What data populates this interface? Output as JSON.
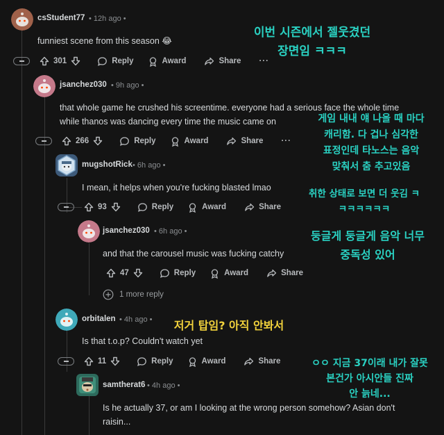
{
  "comments": [
    {
      "author": "csStudent77",
      "time": "12h ago",
      "text": [
        "funniest scene from this season 😂"
      ],
      "votes": "301"
    },
    {
      "author": "jsanchez030",
      "time": "9h ago",
      "text": [
        "that whole game he crushed his screentime. everyone had a serious face the whole time",
        "while thanos was dancing every time the music came on"
      ],
      "votes": "266"
    },
    {
      "author": "mugshotRick",
      "time": "6h ago",
      "text": [
        "I mean, it helps when you're fucking blasted lmao"
      ],
      "votes": "93"
    },
    {
      "author": "jsanchez030",
      "time": "6h ago",
      "text": [
        "and that the carousel music was fucking catchy"
      ],
      "votes": "47"
    },
    {
      "author": "orbitalen",
      "time": "4h ago",
      "text": [
        "Is that t.o.p? Couldn't watch yet"
      ],
      "votes": "11"
    },
    {
      "author": "samtherat6",
      "time": "4h ago",
      "text": [
        "Is he actually 37, or am I looking at the wrong person somehow? Asian don't",
        "raisin..."
      ]
    }
  ],
  "actions": {
    "reply": "Reply",
    "award": "Award",
    "share": "Share",
    "more": "···"
  },
  "more_replies": "1 more reply",
  "dot": "•",
  "translations": [
    [
      "이번 시즌에서 젤웃겼던",
      "장면임 ㅋㅋㅋ"
    ],
    [
      "게임 내내 얘 나올 때 마다",
      "캐리함. 다 겁나 심각한",
      "표정인데 타노스는 음악",
      "맞춰서 춤 추고있음"
    ],
    [
      "취한 상태로 보면 더 웃김 ㅋ",
      "ㅋㅋㅋㅋㅋㅋ"
    ],
    [
      "둥글게 둥글게 음악 너무",
      "중독성 있어"
    ],
    [
      "저거 탑임? 아직 안봐서"
    ],
    [
      "ㅇㅇ 지금 37이래 내가 잘못",
      "본건가 아시안들 진짜",
      "안 늙네..."
    ]
  ],
  "colors": {
    "background": "#141414",
    "text": "#d7dadc",
    "meta": "#8a8d90",
    "overlay": "#2ad1c2"
  }
}
